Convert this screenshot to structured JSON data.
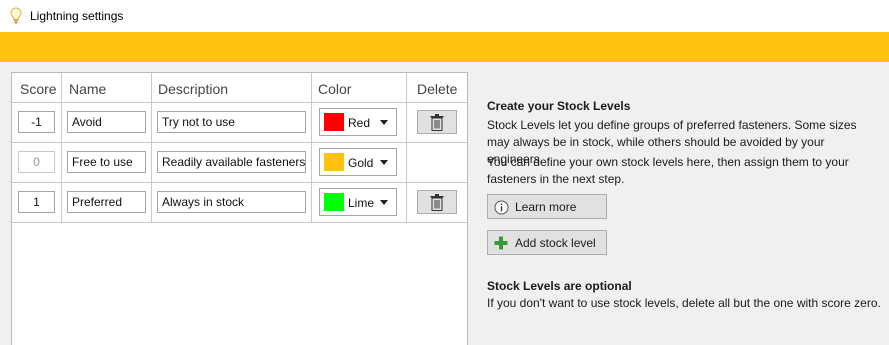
{
  "window": {
    "title": "Lightning settings"
  },
  "colors": {
    "accent": "#ffc20e"
  },
  "table": {
    "headers": {
      "score": "Score",
      "name": "Name",
      "description": "Description",
      "color": "Color",
      "delete": "Delete"
    },
    "rows": [
      {
        "score": "-1",
        "name": "Avoid",
        "description": "Try not to use",
        "color_label": "Red",
        "color_hex": "#ff0000",
        "deletable": true
      },
      {
        "score": "0",
        "name": "Free to use",
        "description": "Readily available fasteners",
        "color_label": "Gold",
        "color_hex": "#ffc20e",
        "deletable": false
      },
      {
        "score": "1",
        "name": "Preferred",
        "description": "Always in stock",
        "color_label": "Lime",
        "color_hex": "#00ff00",
        "deletable": true
      }
    ]
  },
  "info": {
    "heading": "Create your Stock Levels",
    "paragraph1": "Stock Levels let you define groups of preferred fasteners. Some sizes may always be in stock, while others should be avoided by your engineers.",
    "paragraph2": "You can define your own stock levels here, then assign them to your fasteners in the next step.",
    "learn_more_label": "Learn more",
    "learn_more_icon": "info-icon",
    "add_label": "Add stock level",
    "add_icon": "plus-icon",
    "optional_heading": "Stock Levels are optional",
    "optional_text": "If you don't want to use stock levels, delete all but the one with score zero."
  }
}
